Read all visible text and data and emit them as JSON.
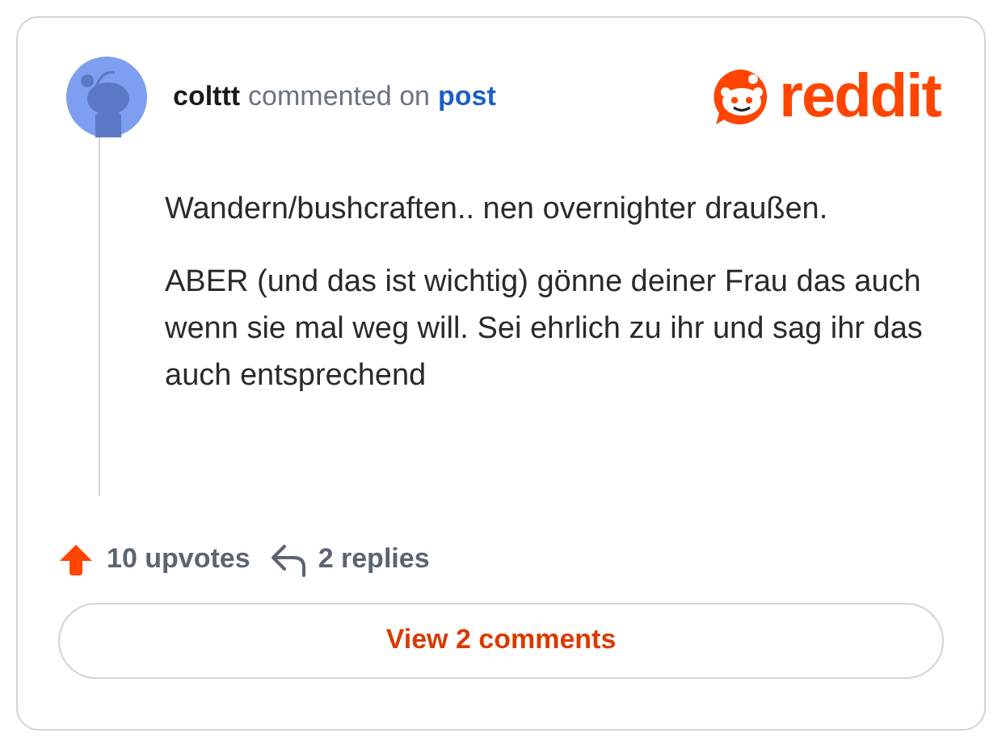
{
  "header": {
    "author": "colttt",
    "action": "commented on",
    "link": "post",
    "brand": "reddit"
  },
  "comment": {
    "paragraphs": [
      "Wandern/bushcraften.. nen overnighter draußen.",
      "ABER (und das ist wichtig) gönne deiner Frau das auch wenn sie mal weg will. Sei ehrlich zu ihr und sag ihr das auch entsprechend"
    ]
  },
  "footer": {
    "upvotes": "10 upvotes",
    "replies": "2 replies",
    "button": "View 2 comments"
  }
}
